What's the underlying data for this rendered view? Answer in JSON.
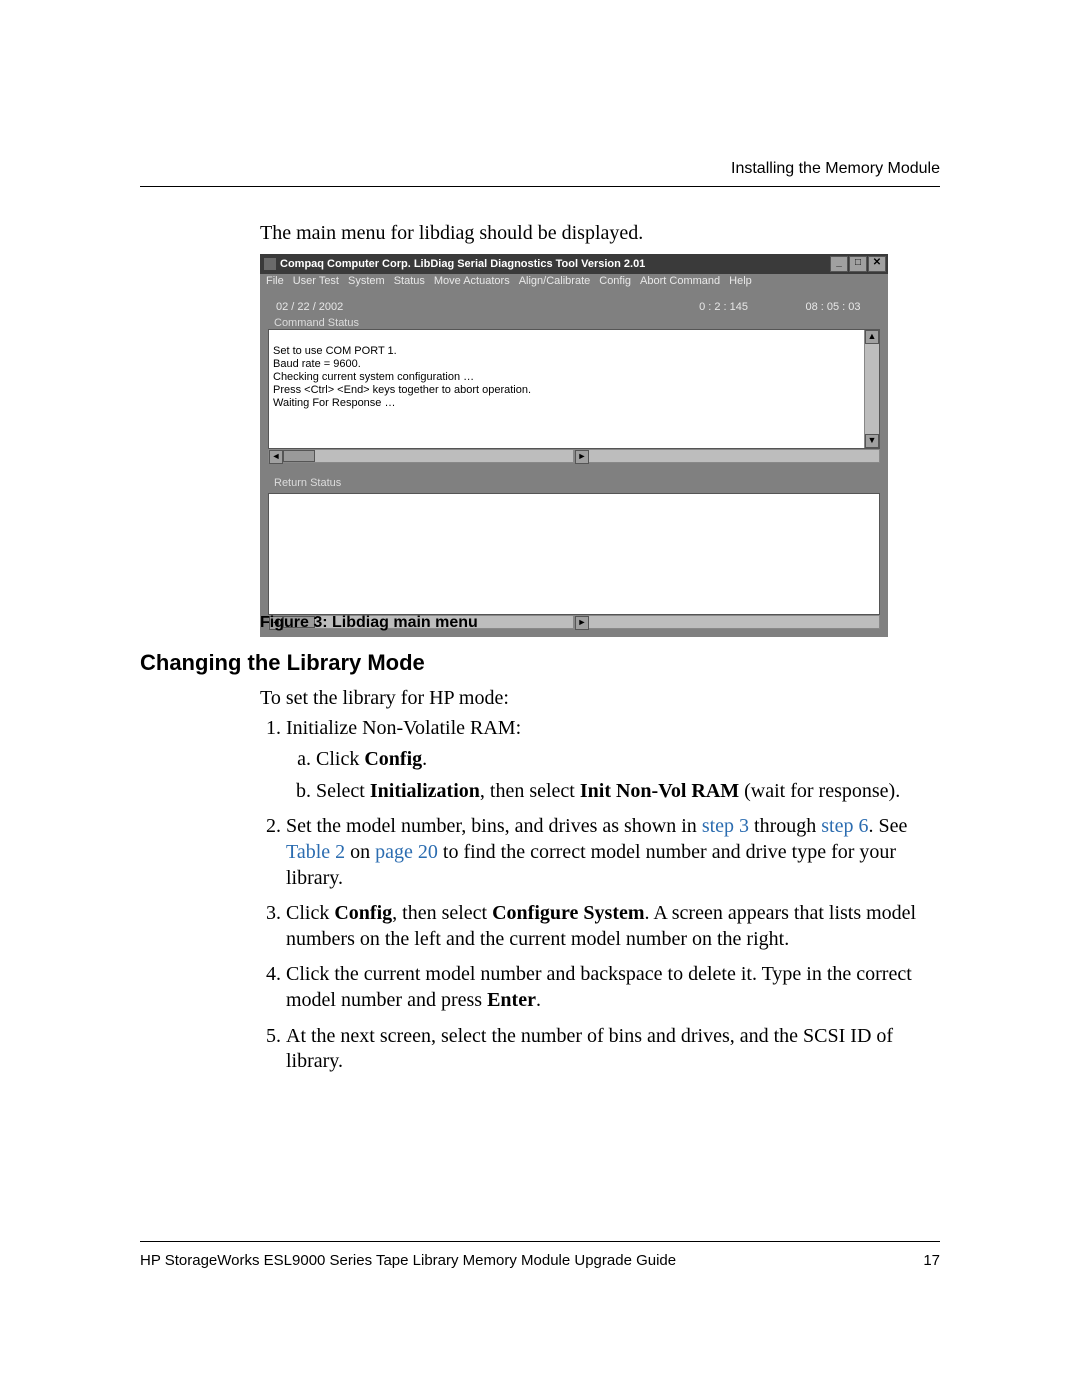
{
  "header": {
    "running_head": "Installing the Memory Module"
  },
  "intro": "The main menu for libdiag should be displayed.",
  "app_window": {
    "title": "Compaq Computer Corp. LibDiag Serial Diagnostics Tool Version 2.01",
    "controls": {
      "minimize": "_",
      "maximize": "□",
      "close": "✕"
    },
    "menu": [
      "File",
      "User Test",
      "System",
      "Status",
      "Move Actuators",
      "Align/Calibrate",
      "Config",
      "Abort Command",
      "Help"
    ],
    "status_row": {
      "date": "02 / 22 / 2002",
      "elapsed": "0 : 2 : 145",
      "clock": "08 : 05 : 03"
    },
    "command_status_label": "Command Status",
    "command_status_lines": [
      "Set to use COM PORT 1.",
      "Baud rate = 9600.",
      "Checking current system configuration …",
      "Press <Ctrl> <End> keys together to abort operation.",
      "Waiting For Response …"
    ],
    "return_status_label": "Return Status"
  },
  "figure_caption": "Figure 3:  Libdiag main menu",
  "section_heading": "Changing the Library Mode",
  "procedure": {
    "lead_in": "To set the library for HP mode:",
    "step1": "Initialize Non-Volatile RAM:",
    "step1a_pre": "Click ",
    "step1a_b1": "Config",
    "step1a_post": ".",
    "step1b_pre": "Select ",
    "step1b_b1": "Initialization",
    "step1b_mid": ", then select ",
    "step1b_b2": "Init Non-Vol RAM",
    "step1b_post": " (wait for response).",
    "step2_pre": "Set the model number, bins, and drives as shown in ",
    "step2_x1": "step 3",
    "step2_mid1": " through ",
    "step2_x2": "step 6",
    "step2_mid2": ". See ",
    "step2_x3": "Table 2",
    "step2_mid3": " on ",
    "step2_x4": "page 20",
    "step2_post": " to find the correct model number and drive type for your library.",
    "step3_pre": "Click ",
    "step3_b1": "Config",
    "step3_mid1": ", then select ",
    "step3_b2": "Configure System",
    "step3_post": ". A screen appears that lists model numbers on the left and the current model number on the right.",
    "step4_pre": "Click the current model number and backspace to delete it. Type in the correct model number and press ",
    "step4_b1": "Enter",
    "step4_post": ".",
    "step5": "At the next screen, select the number of bins and drives, and the SCSI ID of library."
  },
  "footer": {
    "doc_title": "HP StorageWorks ESL9000 Series Tape Library Memory Module Upgrade Guide",
    "page_number": "17"
  }
}
